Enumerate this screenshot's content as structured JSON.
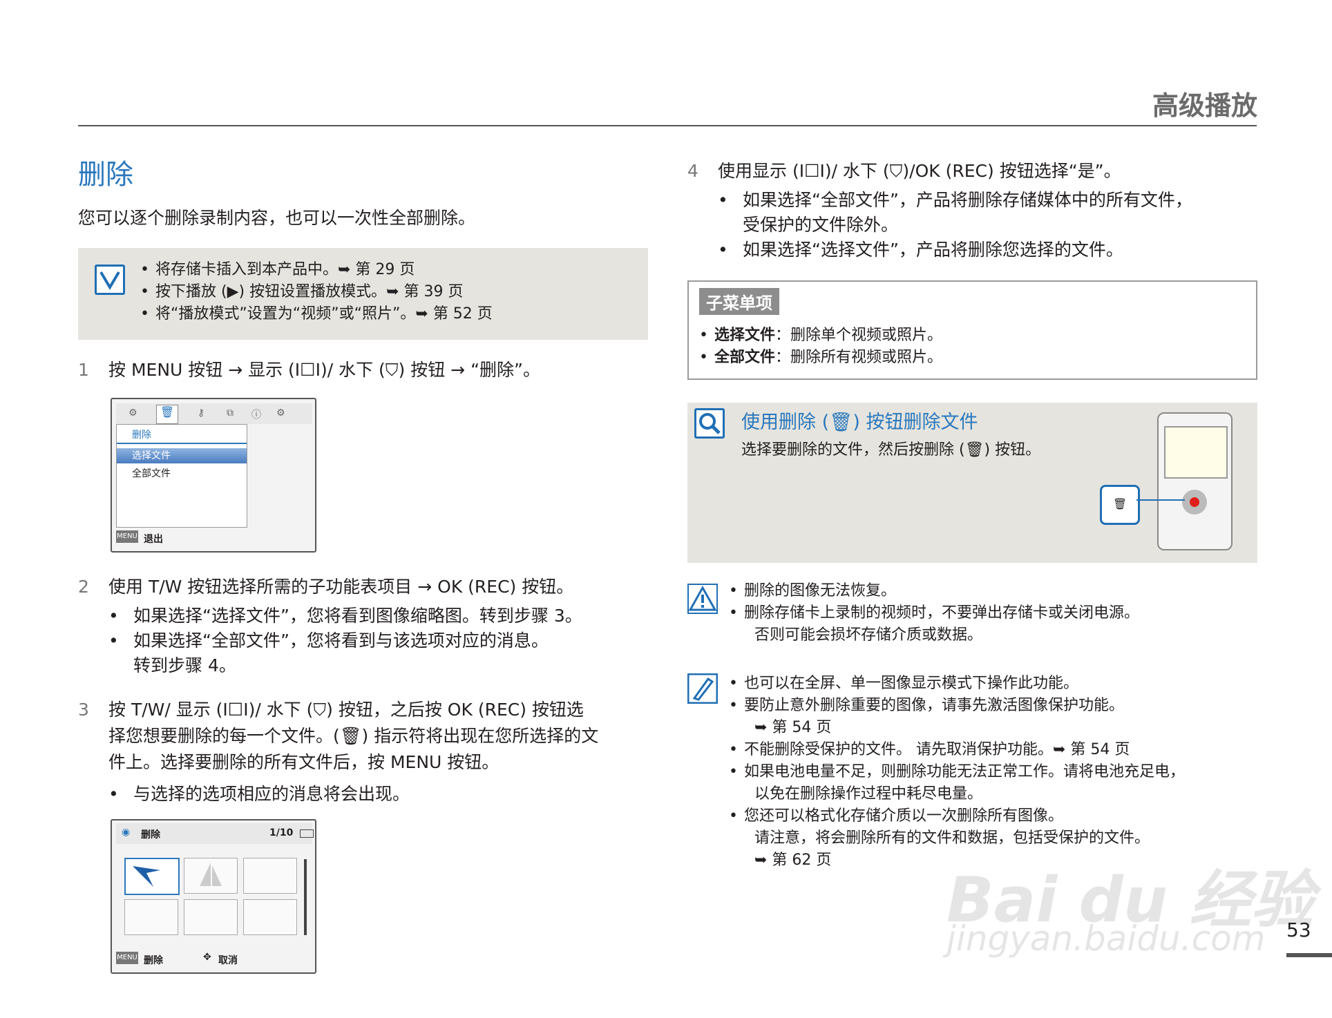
{
  "header": {
    "section_title": "高级播放"
  },
  "left": {
    "title": "删除",
    "intro": "您可以逐个删除录制内容，也可以一次性全部删除。",
    "notes": [
      "将存储卡插入到本产品中。➥ 第 29 页",
      "按下播放 (▶) 按钮设置播放模式。➥ 第 39 页",
      "将“播放模式”设置为“视频”或“照片”。➥ 第 52 页"
    ],
    "step1": {
      "num": "1",
      "text": "按 MENU 按钮 → 显示 (I☐I)/ 水下 (⛉) 按钮 → “删除”。"
    },
    "menu_screen": {
      "title": "删除",
      "items": [
        "选择文件",
        "全部文件"
      ],
      "exit_label": "退出",
      "menu_btn": "MENU"
    },
    "step2": {
      "num": "2",
      "text": "使用 T/W 按钮选择所需的子功能表项目 → OK (REC) 按钮。",
      "bullets": [
        "如果选择“选择文件”，您将看到图像缩略图。转到步骤 3。",
        "如果选择“全部文件”，您将看到与该选项对应的消息。",
        "转到步骤 4。"
      ]
    },
    "step3": {
      "num": "3",
      "lines": [
        "按 T/W/ 显示 (I☐I)/ 水下 (⛉) 按钮，之后按 OK (REC) 按钮选",
        "择您想要删除的每一个文件。(🗑) 指示符将出现在您所选择的文",
        "件上。选择要删除的所有文件后，按 MENU 按钮。"
      ],
      "bullet": "与选择的选项相应的消息将会出现。"
    },
    "thumb_screen": {
      "title": "删除",
      "counter": "1/10",
      "delete_label": "删除",
      "cancel_label": "取消",
      "menu_btn": "MENU"
    }
  },
  "right": {
    "step4": {
      "num": "4",
      "text": "使用显示 (I☐I)/ 水下 (⛉)/OK (REC) 按钮选择“是”。",
      "bullets": [
        "如果选择“全部文件”，产品将删除存储媒体中的所有文件，",
        "受保护的文件除外。",
        "如果选择“选择文件”，产品将删除您选择的文件。"
      ]
    },
    "submenu": {
      "tag": "子菜单项",
      "items": [
        {
          "name": "选择文件",
          "desc": "：删除单个视频或照片。"
        },
        {
          "name": "全部文件",
          "desc": "：删除所有视频或照片。"
        }
      ]
    },
    "tip": {
      "title": "使用删除 (🗑) 按钮删除文件",
      "text": "选择要删除的文件，然后按删除 (🗑) 按钮。"
    },
    "warnings": [
      "删除的图像无法恢复。",
      "删除存储卡上录制的视频时，不要弹出存储卡或关闭电源。",
      "否则可能会损坏存储介质或数据。"
    ],
    "memos": [
      "也可以在全屏、单一图像显示模式下操作此功能。",
      "要防止意外删除重要的图像，请事先激活图像保护功能。",
      "➥ 第 54 页",
      "不能删除受保护的文件。 请先取消保护功能。➥ 第 54 页",
      "如果电池电量不足，则删除功能无法正常工作。请将电池充足电，",
      "以免在删除操作过程中耗尽电量。",
      "您还可以格式化存储介质以一次删除所有图像。",
      "请注意，将会删除所有的文件和数据，包括受保护的文件。",
      "➥ 第 62 页"
    ]
  },
  "footer": {
    "page_number": "53"
  },
  "watermark": {
    "line1": "Bai du 经验",
    "line2": "jingyan.baidu.com"
  },
  "colors": {
    "accent": "#2a78bd",
    "note_bg": "#e5e4df",
    "sub_tag": "#8d8d8d"
  }
}
